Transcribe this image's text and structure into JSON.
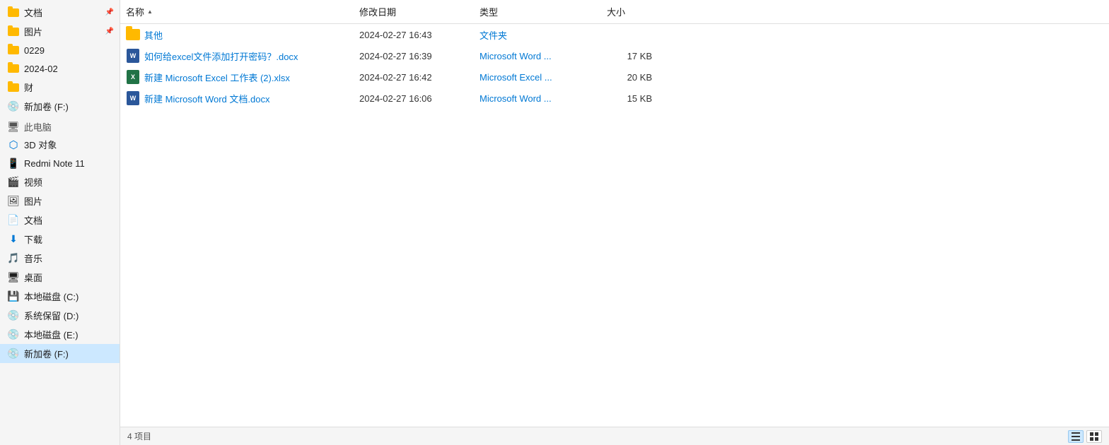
{
  "sidebar": {
    "pinned_items": [
      {
        "label": "文档",
        "icon_type": "folder",
        "pinned": true
      },
      {
        "label": "图片",
        "icon_type": "folder",
        "pinned": true
      },
      {
        "label": "0229",
        "icon_type": "folder",
        "pinned": false
      },
      {
        "label": "2024-02",
        "icon_type": "folder",
        "pinned": false
      },
      {
        "label": "财",
        "icon_type": "folder",
        "pinned": false
      }
    ],
    "drive_items": [
      {
        "label": "新加卷 (F:)",
        "icon_type": "drive"
      }
    ],
    "pc_section": "此电脑",
    "pc_items": [
      {
        "label": "3D 对象",
        "icon_type": "3d"
      },
      {
        "label": "Redmi Note 11",
        "icon_type": "phone"
      },
      {
        "label": "视频",
        "icon_type": "video"
      },
      {
        "label": "图片",
        "icon_type": "picture"
      },
      {
        "label": "文档",
        "icon_type": "docs"
      },
      {
        "label": "下载",
        "icon_type": "download"
      },
      {
        "label": "音乐",
        "icon_type": "music"
      },
      {
        "label": "桌面",
        "icon_type": "desktop"
      },
      {
        "label": "本地磁盘 (C:)",
        "icon_type": "drive"
      },
      {
        "label": "系统保留 (D:)",
        "icon_type": "drive"
      },
      {
        "label": "本地磁盘 (E:)",
        "icon_type": "drive"
      },
      {
        "label": "新加卷 (F:)",
        "icon_type": "drive",
        "active": true
      }
    ]
  },
  "columns": {
    "name": "名称",
    "date": "修改日期",
    "type": "类型",
    "size": "大小"
  },
  "files": [
    {
      "name": "其他",
      "date": "2024-02-27 16:43",
      "type": "文件夹",
      "size": "",
      "icon_type": "folder"
    },
    {
      "name": "如何给excel文件添加打开密码？.docx",
      "date": "2024-02-27 16:39",
      "type": "Microsoft Word ...",
      "size": "17 KB",
      "icon_type": "word"
    },
    {
      "name": "新建 Microsoft Excel 工作表 (2).xlsx",
      "date": "2024-02-27 16:42",
      "type": "Microsoft Excel ...",
      "size": "20 KB",
      "icon_type": "excel"
    },
    {
      "name": "新建 Microsoft Word 文档.docx",
      "date": "2024-02-27 16:06",
      "type": "Microsoft Word ...",
      "size": "15 KB",
      "icon_type": "word"
    }
  ],
  "status_bar": {
    "item_count": "4 项目"
  }
}
